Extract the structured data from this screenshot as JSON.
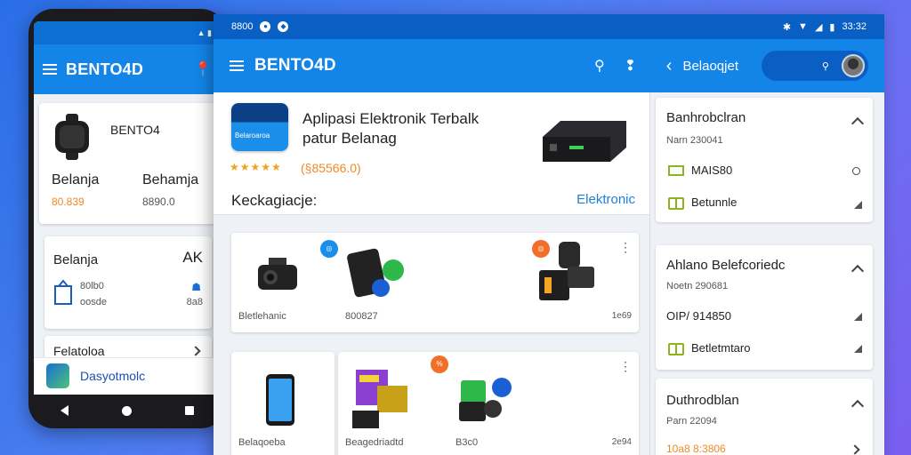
{
  "colors": {
    "appbar": "#1384e8",
    "status": "#0a5fc4",
    "accent_link": "#1e7fd6",
    "price": "#f08a24",
    "stars": "#f2a11b",
    "book_green": "#8fb21f"
  },
  "phone": {
    "brand": "BENTO4D",
    "card1": {
      "title": "BENTO4",
      "col1_label": "Belanja",
      "col1_price": "80.839",
      "col2_label": "Behamja",
      "col2_price": "8890.0"
    },
    "card2": {
      "title": "Belanja",
      "right": "AK",
      "item_label": "80lb0",
      "item_sub": "oosde",
      "right_val": "8a8"
    },
    "list_item": "Felatoloa",
    "app_label": "Dasyotmolc"
  },
  "tablet": {
    "status_left": "8800",
    "status_time": "33:32",
    "brand": "BENTO4D",
    "title2": "Belaoqjet",
    "hero": {
      "logo_text": "Belaroaroa",
      "title_line1": "Aplipasi Elektronik Terbalk",
      "title_line2": "patur Belanag",
      "stars": "★★★★★",
      "price": "(§85566.0)"
    },
    "section_title": "Keckagiacje:",
    "section_link": "Elektronic",
    "row1": [
      {
        "label": "Bletlehanic"
      },
      {
        "label": "800827"
      },
      {
        "label": "1e69"
      }
    ],
    "row2": [
      {
        "label": "Belaqoeba"
      },
      {
        "label": "Beagedriadtd"
      },
      {
        "label": "B3c0"
      },
      {
        "label": "2e94"
      }
    ]
  },
  "sidebar": {
    "groups": [
      {
        "title": "Banhrobclran",
        "sub": "Narn 230041",
        "rows": [
          {
            "text": "MAIS80",
            "icon": "flag-icon"
          },
          {
            "text": "Betunnle",
            "icon": "book-icon"
          }
        ]
      },
      {
        "title": "Ahlano Belefcoriedc",
        "sub": "Noetn 290681",
        "rows": [
          {
            "text": "OIP/ 914850",
            "icon": "none"
          },
          {
            "text": "Betletmtaro",
            "icon": "book-icon"
          }
        ]
      },
      {
        "title": "Duthrodblan",
        "sub": "Parn 22094",
        "rows": [
          {
            "text": "10a8 8:3806",
            "icon": "none"
          }
        ]
      }
    ]
  }
}
